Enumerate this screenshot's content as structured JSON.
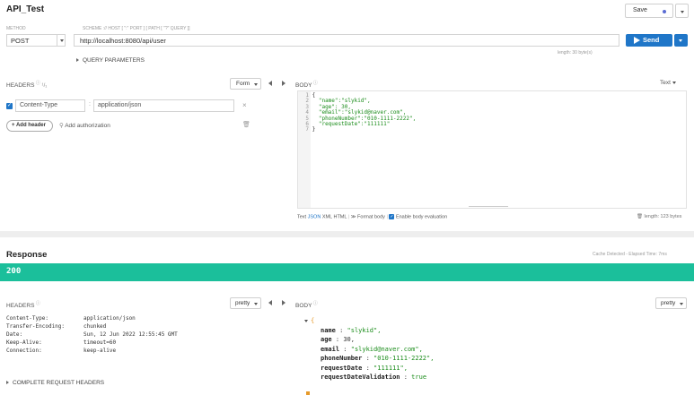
{
  "request": {
    "title": "API_Test",
    "save_label": "Save",
    "method_label": "METHOD",
    "method_value": "POST",
    "scheme_label": "SCHEME :// HOST [ \":\" PORT ] [ PATH [ \"?\" QUERY ]]",
    "url": "http://localhost:8080/api/user",
    "send_label": "Send",
    "length_text": "length: 30 byte(s)",
    "query_params_label": "QUERY PARAMETERS",
    "headers_label": "HEADERS",
    "headers_count": "¹/₁",
    "form_label": "Form",
    "body_label": "BODY",
    "text_label": "Text",
    "header_key": "Content-Type",
    "header_value": "application/json",
    "add_header_label": "+ Add header",
    "add_auth_label": "Add authorization",
    "body_lines": [
      {
        "num": "1",
        "text": "{"
      },
      {
        "num": "2",
        "text": "  \"name\":\"slykid\","
      },
      {
        "num": "3",
        "text": "  \"age\": 30,"
      },
      {
        "num": "4",
        "text": "  \"email\":\"slykid@naver.com\","
      },
      {
        "num": "5",
        "text": "  \"phoneNumber\":\"010-1111-2222\","
      },
      {
        "num": "6",
        "text": "  \"requestDate\":\"111111\""
      },
      {
        "num": "7",
        "text": "}"
      }
    ],
    "body_modes": [
      "Text",
      "JSON",
      "XML",
      "HTML"
    ],
    "format_body_label": "Format body",
    "enable_eval_label": "Enable body evaluation",
    "body_length": "length: 123 bytes"
  },
  "response": {
    "title": "Response",
    "cache_text": "Cache Detected - Elapsed Time: 7ms",
    "status_code": "200",
    "headers_label": "HEADERS",
    "pretty_label": "pretty",
    "body_label": "BODY",
    "headers": [
      {
        "name": "Content-Type:",
        "value": "application/json"
      },
      {
        "name": "Transfer-Encoding:",
        "value": "chunked"
      },
      {
        "name": "Date:",
        "value": "Sun, 12 Jun 2022 12:55:45 GMT"
      },
      {
        "name": "Keep-Alive:",
        "value": "timeout=60"
      },
      {
        "name": "Connection:",
        "value": "keep-alive"
      }
    ],
    "complete_headers_label": "COMPLETE REQUEST HEADERS",
    "json": [
      {
        "key": "name",
        "value": "\"slykid\","
      },
      {
        "key": "age",
        "value": "30,"
      },
      {
        "key": "email",
        "value": "\"slykid@naver.com\","
      },
      {
        "key": "phoneNumber",
        "value": "\"010-1111-2222\","
      },
      {
        "key": "requestDate",
        "value": "\"111111\","
      },
      {
        "key": "requestDateValidation",
        "value": "true"
      }
    ]
  },
  "colors": {
    "accent": "#1f76c8",
    "status_green": "#1bbf9b",
    "save_dot": "#5b6cd4"
  }
}
